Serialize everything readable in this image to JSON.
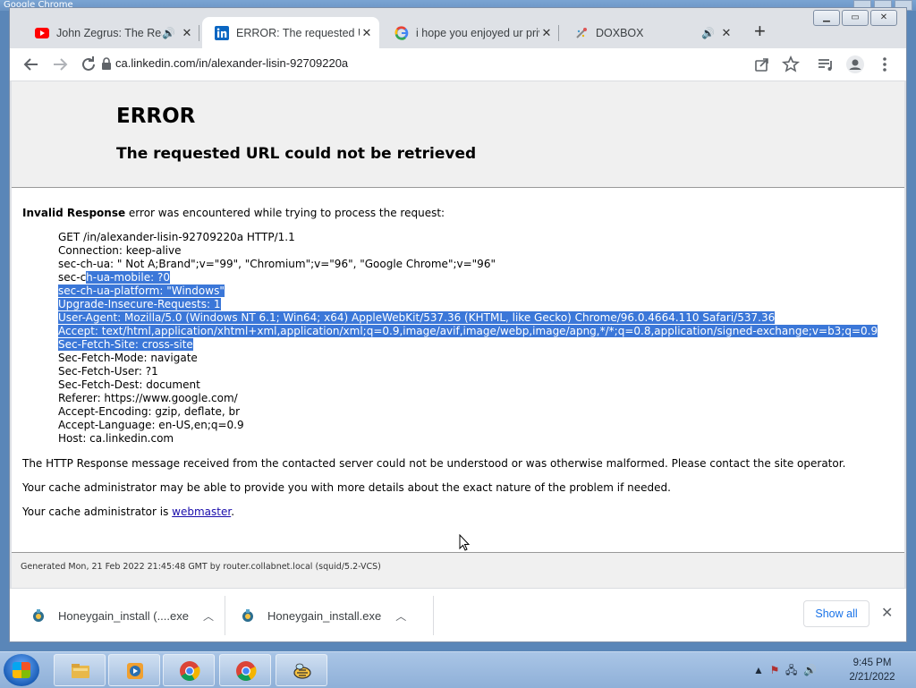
{
  "os": {
    "background_window_title": "Google Chrome",
    "clock_time": "9:45 PM",
    "clock_date": "2/21/2022",
    "taskbar_apps": [
      "file-explorer",
      "media-player",
      "chrome",
      "chrome",
      "honeygain"
    ]
  },
  "tabs": [
    {
      "title": "John Zegrus: The Real",
      "favicon": "youtube-icon",
      "audio": true,
      "active": false
    },
    {
      "title": "ERROR: The requested UR",
      "favicon": "linkedin-icon",
      "audio": false,
      "active": true
    },
    {
      "title": "i hope you enjoyed ur priv",
      "favicon": "google-icon",
      "audio": false,
      "active": false
    },
    {
      "title": "DOXBOX",
      "favicon": "doxbox-icon",
      "audio": true,
      "active": false
    }
  ],
  "toolbar": {
    "url": "ca.linkedin.com/in/alexander-lisin-92709220a"
  },
  "page": {
    "h1": "ERROR",
    "h2": "The requested URL could not be retrieved",
    "intro_bold": "Invalid Response",
    "intro_rest": " error was encountered while trying to process the request:",
    "request_lines": [
      {
        "text": "GET /in/alexander-lisin-92709220a HTTP/1.1"
      },
      {
        "text": "Connection: keep-alive"
      },
      {
        "text": "sec-ch-ua: \" Not A;Brand\";v=\"99\", \"Chromium\";v=\"96\", \"Google Chrome\";v=\"96\""
      },
      {
        "pre": "sec-c",
        "sel": "h-ua-mobile: ?0"
      },
      {
        "sel": "sec-ch-ua-platform: \"Windows\""
      },
      {
        "sel": "Upgrade-Insecure-Requests: 1"
      },
      {
        "sel": "User-Agent: Mozilla/5.0 (Windows NT 6.1; Win64; x64) AppleWebKit/537.36 (KHTML, like Gecko) Chrome/96.0.4664.110 Safari/537.36"
      },
      {
        "sel": "Accept: text/html,application/xhtml+xml,application/xml;q=0.9,image/avif,image/webp,image/apng,*/*;q=0.8,application/signed-exchange;v=b3;q=0.9"
      },
      {
        "sel": "Sec-Fetch-Site: cross-site"
      },
      {
        "text": "Sec-Fetch-Mode: navigate"
      },
      {
        "text": "Sec-Fetch-User: ?1"
      },
      {
        "text": "Sec-Fetch-Dest: document"
      },
      {
        "text": "Referer: https://www.google.com/"
      },
      {
        "text": "Accept-Encoding: gzip, deflate, br"
      },
      {
        "text": "Accept-Language: en-US,en;q=0.9"
      },
      {
        "text": "Host: ca.linkedin.com"
      }
    ],
    "para1": "The HTTP Response message received from the contacted server could not be understood or was otherwise malformed. Please contact the site operator.",
    "para2": "Your cache administrator may be able to provide you with more details about the exact nature of the problem if needed.",
    "para3_prefix": "Your cache administrator is ",
    "para3_link": "webmaster",
    "para3_suffix": ".",
    "footer": "Generated Mon, 21 Feb 2022 21:45:48 GMT by router.collabnet.local (squid/5.2-VCS)"
  },
  "downloads": {
    "items": [
      "Honeygain_install (....exe",
      "Honeygain_install.exe"
    ],
    "show_all": "Show all"
  }
}
